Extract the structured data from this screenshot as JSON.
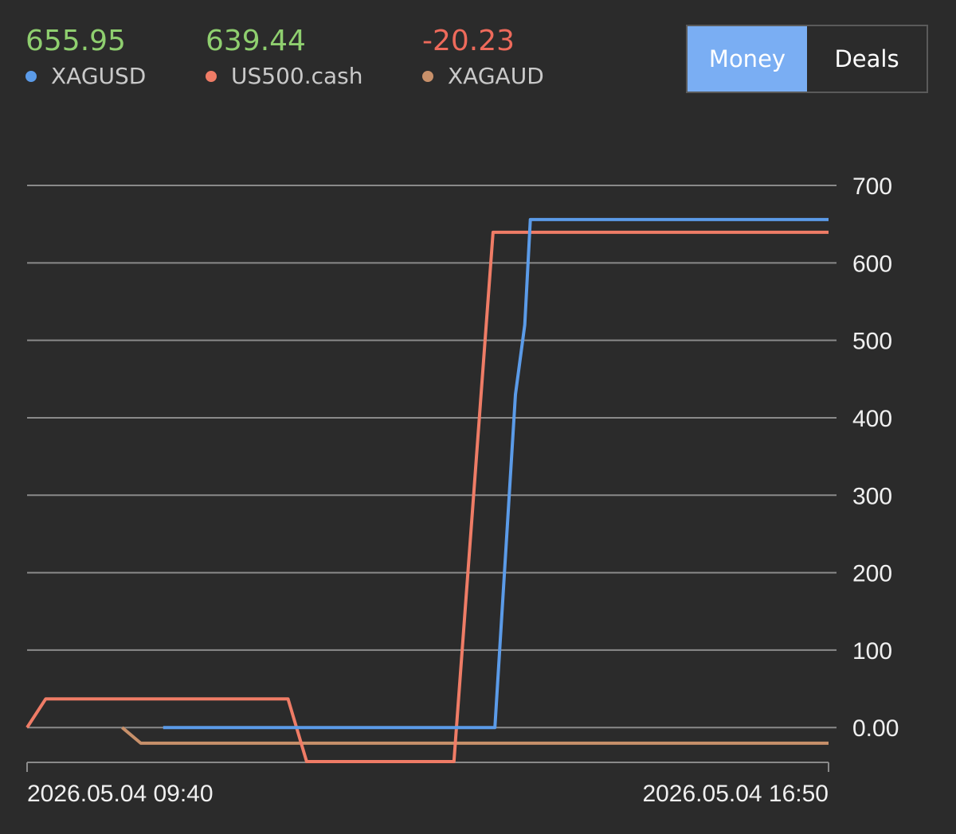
{
  "colors": {
    "background": "#2b2b2b",
    "positive": "#8fcf6f",
    "negative": "#ee6a5b",
    "grid": "#8a8a8a",
    "toggle_active": "#7aaef3"
  },
  "legend": [
    {
      "value": "655.95",
      "name": "XAGUSD",
      "value_color": "#8fcf6f",
      "dot_color": "#5b9be8"
    },
    {
      "value": "639.44",
      "name": "US500.cash",
      "value_color": "#8fcf6f",
      "dot_color": "#ef7c66"
    },
    {
      "value": "-20.23",
      "name": "XAGAUD",
      "value_color": "#ee6a5b",
      "dot_color": "#c8906a"
    }
  ],
  "toggle": {
    "money_label": "Money",
    "deals_label": "Deals",
    "active": "money"
  },
  "chart_data": {
    "type": "line",
    "xlabel": "",
    "ylabel": "",
    "y_axis_position": "right",
    "ylim": [
      -45,
      700
    ],
    "y_ticks": [
      {
        "value": 700,
        "label": "700"
      },
      {
        "value": 600,
        "label": "600"
      },
      {
        "value": 500,
        "label": "500"
      },
      {
        "value": 400,
        "label": "400"
      },
      {
        "value": 300,
        "label": "300"
      },
      {
        "value": 200,
        "label": "200"
      },
      {
        "value": 100,
        "label": "100"
      },
      {
        "value": 0,
        "label": "0.00"
      }
    ],
    "xlim": [
      "2026-05-04 09:40",
      "2026-05-04 16:50"
    ],
    "x_ticks": [
      "2026.05.04 09:40",
      "2026.05.04 16:50"
    ],
    "grid": true,
    "series": [
      {
        "name": "XAGUSD",
        "color": "#5b9be8",
        "points": [
          [
            "2026-05-04 10:53",
            0
          ],
          [
            "2026-05-04 13:51",
            0
          ],
          [
            "2026-05-04 14:02",
            430
          ],
          [
            "2026-05-04 14:07",
            520
          ],
          [
            "2026-05-04 14:10",
            655.95
          ],
          [
            "2026-05-04 16:50",
            655.95
          ]
        ]
      },
      {
        "name": "US500.cash",
        "color": "#ef7c66",
        "points": [
          [
            "2026-05-04 09:40",
            0
          ],
          [
            "2026-05-04 09:50",
            37
          ],
          [
            "2026-05-04 12:00",
            37
          ],
          [
            "2026-05-04 12:10",
            -44
          ],
          [
            "2026-05-04 13:29",
            -44
          ],
          [
            "2026-05-04 13:50",
            639.44
          ],
          [
            "2026-05-04 16:50",
            639.44
          ]
        ]
      },
      {
        "name": "XAGAUD",
        "color": "#c8906a",
        "points": [
          [
            "2026-05-04 10:31",
            0
          ],
          [
            "2026-05-04 10:41",
            -20.23
          ],
          [
            "2026-05-04 16:50",
            -20.23
          ]
        ]
      }
    ]
  }
}
